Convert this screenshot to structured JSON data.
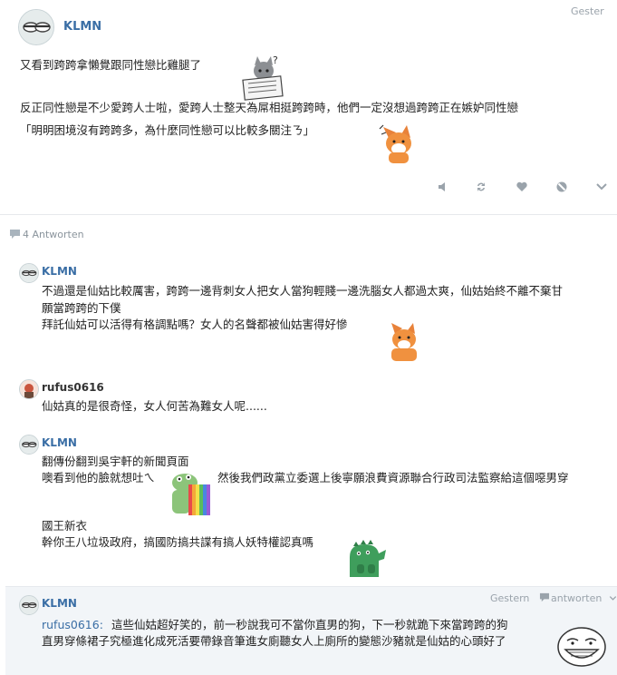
{
  "post": {
    "username": "KLMN",
    "timestamp": "Gester",
    "lines": [
      "又看到跨跨拿懶覺跟同性戀比雞腿了",
      "反正同性戀是不少愛跨人士啦，愛跨人士整天為屌相挺跨跨時，他們一定沒想過跨跨正在嫉妒同性戀",
      "「明明困境沒有跨跨多，為什麼同性戀可以比較多關注ㄋ」"
    ],
    "actions": [
      "mute-icon",
      "repost-icon",
      "like-icon",
      "block-icon",
      "chevron-down-icon"
    ]
  },
  "replies_header": {
    "count_label": "4 Antworten"
  },
  "replies": [
    {
      "username": "KLMN",
      "lines": [
        "不過還是仙姑比較厲害，跨跨一邊背刺女人把女人當狗輕賤一邊洗腦女人都過太爽，仙姑始終不離不棄甘",
        "願當跨跨的下僕",
        "拜託仙姑可以活得有格調點嗎？女人的名聲都被仙姑害得好慘"
      ]
    },
    {
      "username": "rufus0616",
      "lines": [
        "仙姑真的是很奇怪，女人何苦為難女人呢......"
      ]
    },
    {
      "username": "KLMN",
      "lines": [
        "翻傳份翻到吳宇軒的新聞頁面",
        "噢看到他的臉就想吐ㄟ",
        "然後我們政黨立委選上後寧願浪費資源聯合行政司法監察給這個噁男穿",
        "國王新衣",
        "幹你王八垃圾政府，搞國防搞共諜有搞人妖特權認真嗎"
      ]
    }
  ],
  "highlighted": {
    "username": "KLMN",
    "timestamp": "Gestern",
    "reply_label": "antworten",
    "mention": "rufus0616:",
    "line1": "這些仙姑超好笑的，前一秒說我可不當你直男的狗，下一秒就跪下來當跨跨的狗",
    "line2": "直男穿條裙子究極進化成死活要帶錄音筆進女廁聽女人上廁所的變態沙豬就是仙姑的心頭好了"
  },
  "colors": {
    "username": "#3a6ea5",
    "highlight_bg": "#f2f5f8",
    "muted": "#9aa3ab"
  }
}
